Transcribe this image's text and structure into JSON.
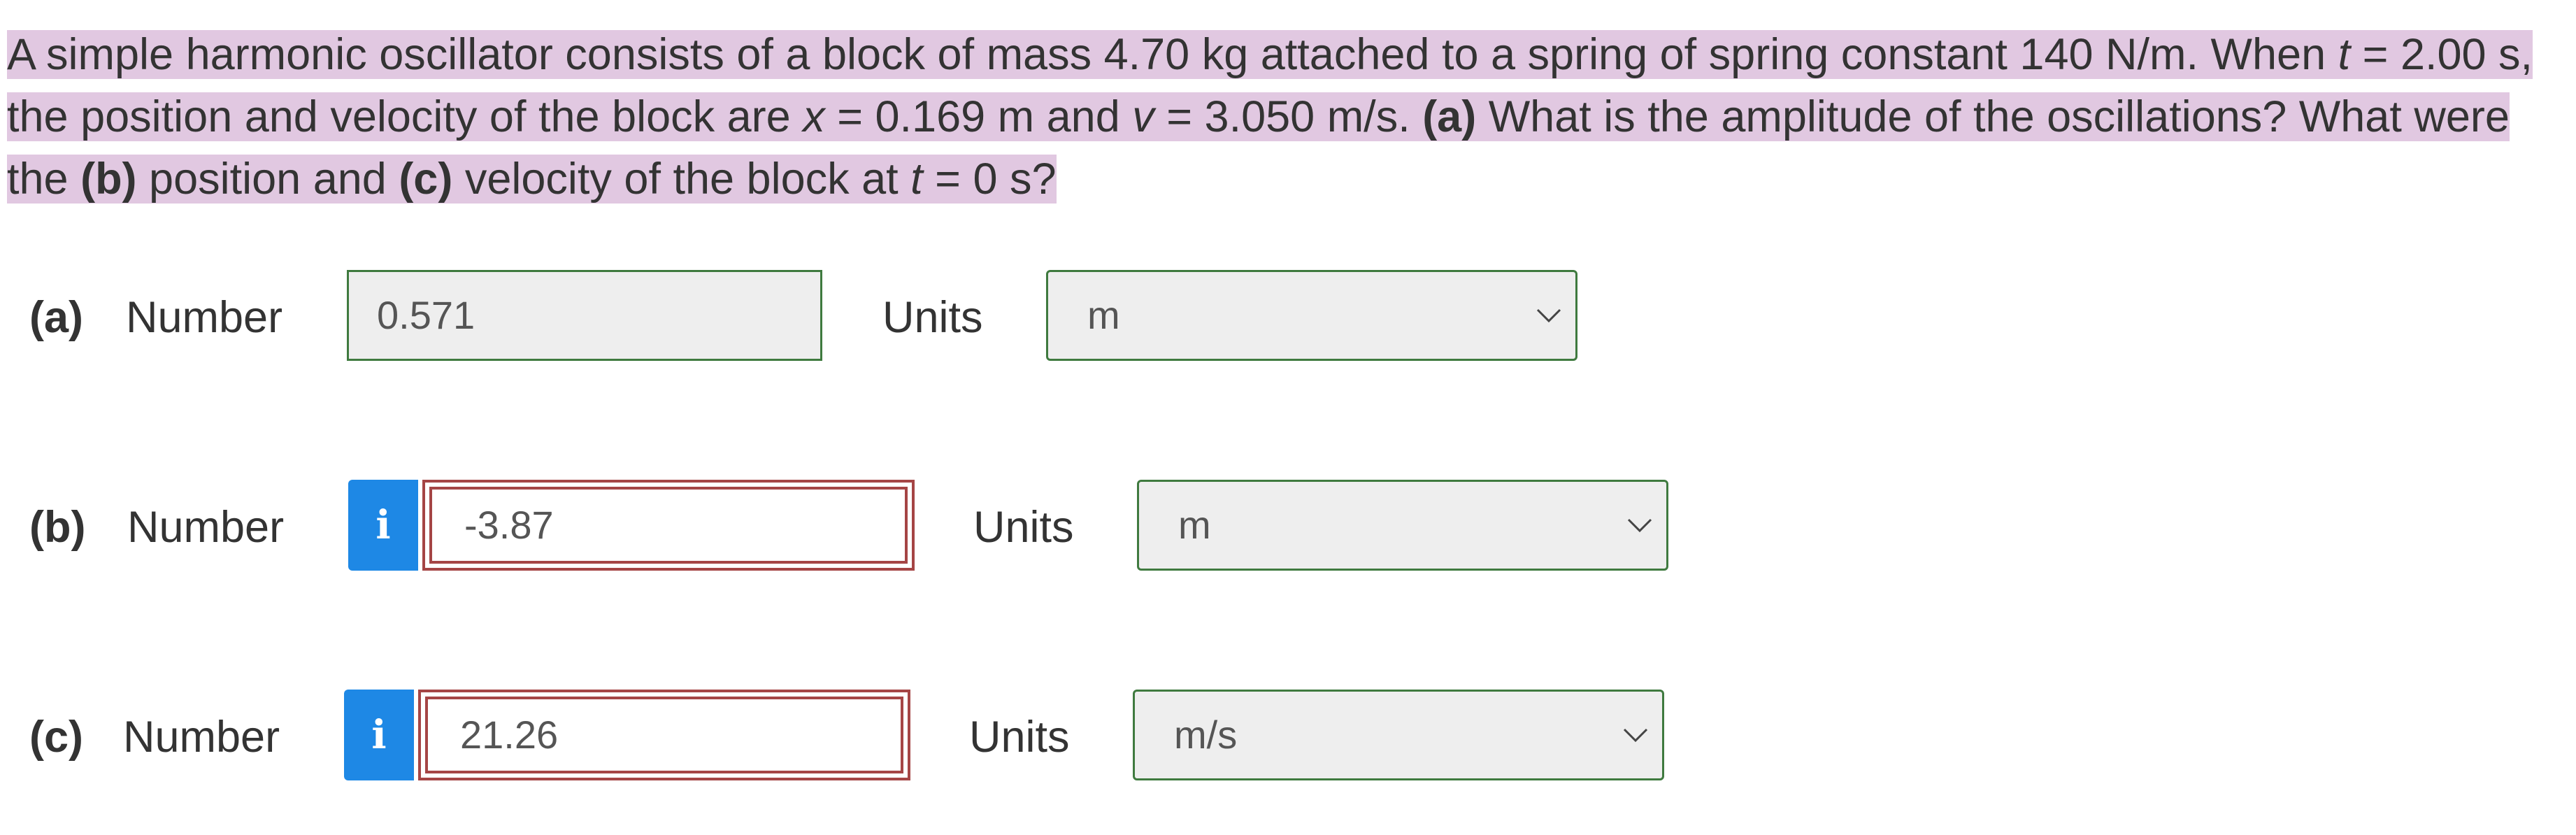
{
  "question": {
    "p1": "A simple harmonic oscillator consists of a block of mass 4.70 kg attached to a spring of spring constant 140 N/m. When ",
    "t1": "t",
    "p2": " = 2.00 s, the position and velocity of the block are ",
    "x": "x",
    "p3": " = 0.169 m and ",
    "v": "v",
    "p4": " = 3.050 m/s. ",
    "a_label": "(a)",
    "p5": " What is the amplitude of the oscillations? What were the ",
    "b_label": "(b)",
    "p6": " position and ",
    "c_label": "(c)",
    "p7": " velocity of the block at ",
    "t2": "t",
    "p8": " = 0 s?"
  },
  "parts": [
    {
      "label": "(a)",
      "number_label": "Number",
      "value": "0.571",
      "units_label": "Units",
      "unit": "m",
      "status": "correct"
    },
    {
      "label": "(b)",
      "number_label": "Number",
      "info_icon": "i",
      "value": "-3.87",
      "units_label": "Units",
      "unit": "m",
      "status": "incorrect"
    },
    {
      "label": "(c)",
      "number_label": "Number",
      "info_icon": "i",
      "value": "21.26",
      "units_label": "Units",
      "unit": "m/s",
      "status": "incorrect"
    }
  ],
  "colors": {
    "highlight": "#e1c8e1",
    "correct_border": "#3f7a3f",
    "incorrect_border": "#a54545",
    "info_button": "#1e88e5"
  }
}
